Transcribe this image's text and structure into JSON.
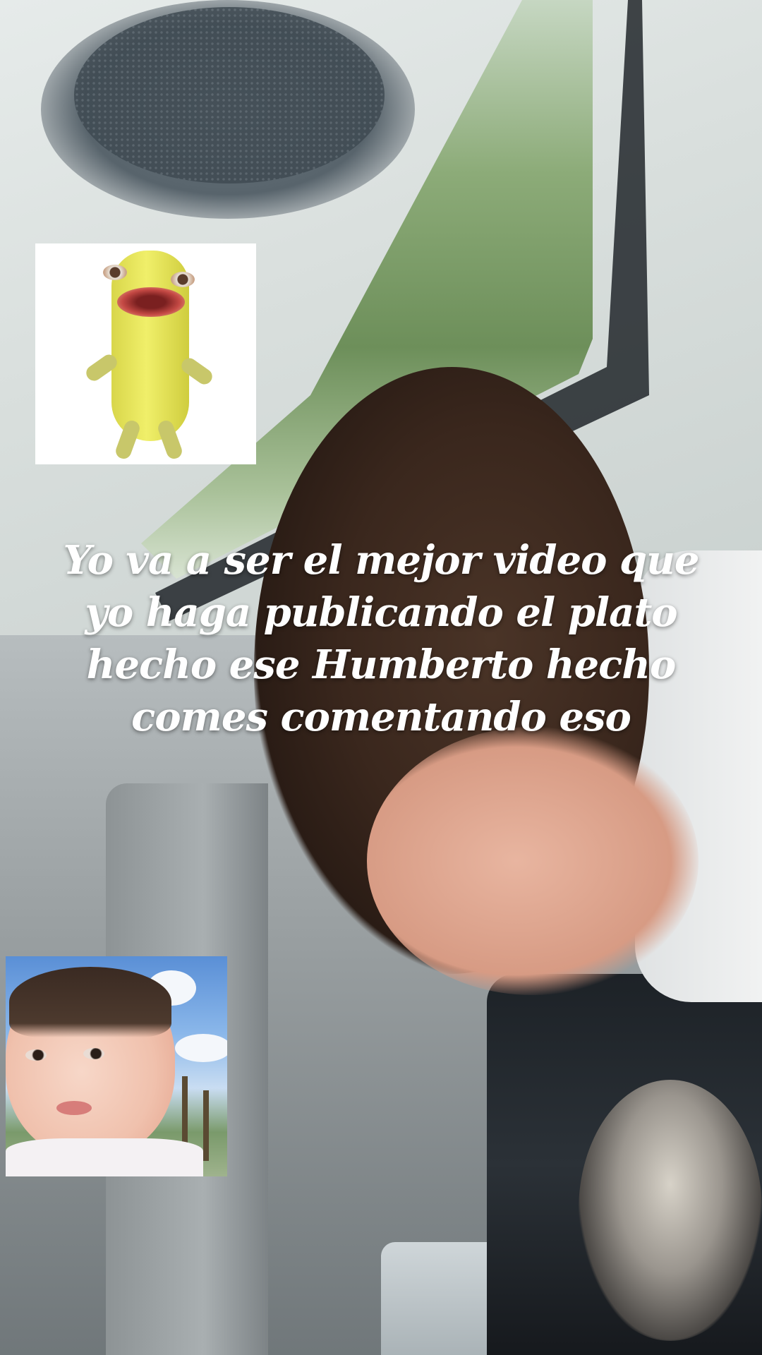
{
  "caption": {
    "line1": "Yo va a ser el mejor video que",
    "line2": "yo haga publicando el plato",
    "line3": "hecho ese Humberto hecho",
    "line4": "comes comentando eso"
  },
  "colors": {
    "caption_text": "#ffffff",
    "sticker_background": "#ffffff"
  }
}
